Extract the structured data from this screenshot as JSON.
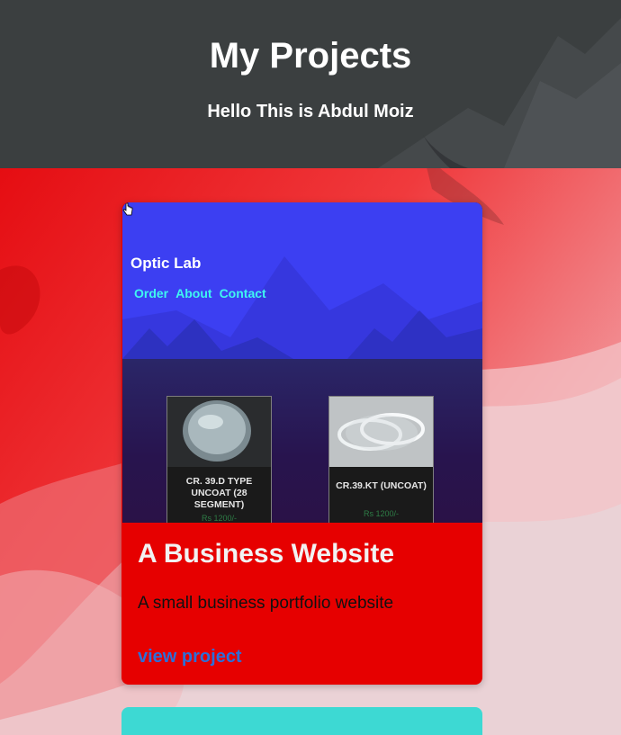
{
  "header": {
    "title": "My Projects",
    "subtitle": "Hello This is Abdul Moiz"
  },
  "projects": [
    {
      "title": "A Business Website",
      "description": "A small business portfolio website",
      "link_label": "view project",
      "accent_color": "#e60000",
      "thumbnail": {
        "brand": "Optic Lab",
        "nav": [
          "Order",
          "About",
          "Contact"
        ],
        "products": [
          {
            "name": "CR. 39.D TYPE UNCOAT (28 SEGMENT)",
            "price": "Rs 1200/-"
          },
          {
            "name": "CR.39.KT (UNCOAT)",
            "price": "Rs 1200/-"
          }
        ]
      }
    },
    {
      "accent_color": "#3dd9d3"
    }
  ],
  "icons": {
    "cursor": "hand-pointer-icon"
  }
}
